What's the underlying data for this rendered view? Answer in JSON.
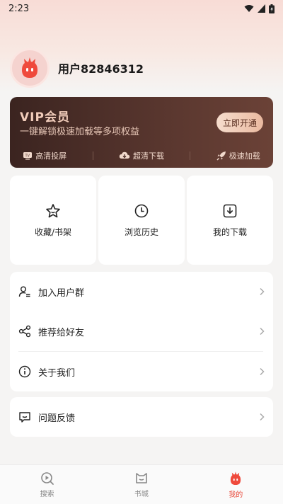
{
  "status_bar": {
    "time": "2:23"
  },
  "profile": {
    "username": "用户82846312"
  },
  "vip": {
    "title": "VIP会员",
    "description": "一键解锁极速加载等多项权益",
    "button": "立即开通",
    "benefits": [
      {
        "label": "高清投屏",
        "icon": "tv-icon"
      },
      {
        "label": "超清下载",
        "icon": "cloud-download-icon"
      },
      {
        "label": "极速加载",
        "icon": "rocket-icon"
      }
    ]
  },
  "quick_actions": [
    {
      "label": "收藏/书架",
      "icon": "star-icon"
    },
    {
      "label": "浏览历史",
      "icon": "clock-icon"
    },
    {
      "label": "我的下载",
      "icon": "download-icon"
    }
  ],
  "menu": [
    {
      "label": "加入用户群",
      "icon": "user-group-icon"
    },
    {
      "label": "推荐给好友",
      "icon": "share-icon"
    },
    {
      "label": "关于我们",
      "icon": "info-icon"
    }
  ],
  "feedback": {
    "label": "问题反馈",
    "icon": "feedback-icon"
  },
  "tabs": [
    {
      "label": "搜索",
      "icon": "play-search-icon",
      "active": false
    },
    {
      "label": "书城",
      "icon": "bookstore-icon",
      "active": false
    },
    {
      "label": "我的",
      "icon": "mascot-icon",
      "active": true
    }
  ],
  "colors": {
    "accent": "#e8483a",
    "vip_bg": "#3b2420",
    "vip_gold": "#f2cdbb"
  }
}
